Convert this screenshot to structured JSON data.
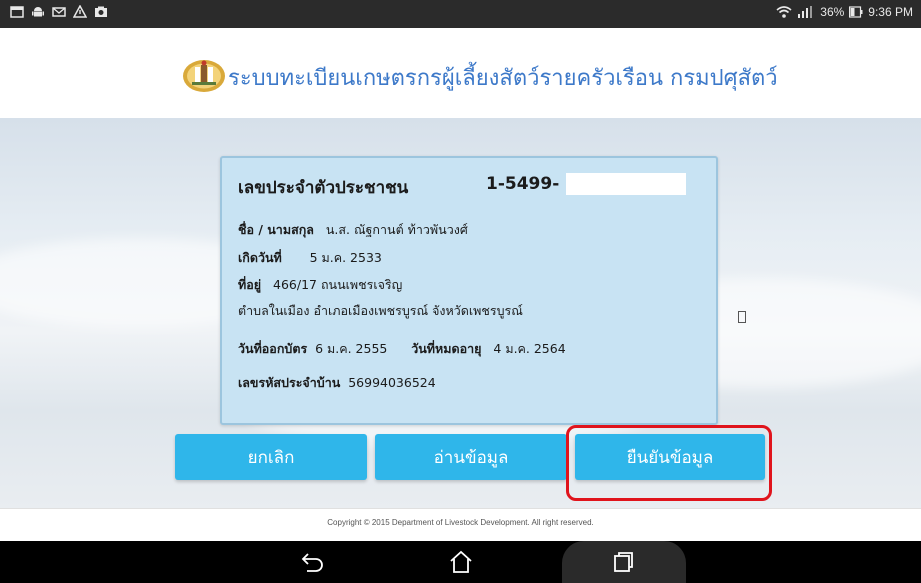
{
  "status_bar": {
    "left_icons": [
      "screen-icon",
      "android-icon",
      "mail-icon",
      "warning-icon",
      "photo-icon"
    ],
    "battery_percent": "36%",
    "time": "9:36 PM"
  },
  "header": {
    "title": "ระบบทะเบียนเกษตรกรผู้เลี้ยงสัตว์รายครัวเรือน กรมปศุสัตว์",
    "logo_icon": "department-seal-icon"
  },
  "card": {
    "title": "เลขประจำตัวประชาชน",
    "id_number": "1-5499-",
    "name_label": "ชื่อ / นามสกุล",
    "name_value": "น.ส. ณัฐกานต์ ท้าวพันวงศ์",
    "birth_label": "เกิดวันที่",
    "birth_value": "5 ม.ค. 2533",
    "address_label": "ที่อยู่",
    "address_line1": "466/17  ถนนเพชรเจริญ",
    "address_line2": "ตำบลในเมือง อำเภอเมืองเพชรบูรณ์ จังหวัดเพชรบูรณ์",
    "issue_label": "วันที่ออกบัตร",
    "issue_value": "6 ม.ค. 2555",
    "expire_label": "วันที่หมดอายุ",
    "expire_value": "4 ม.ค. 2564",
    "house_label": "เลขรหัสประจำบ้าน",
    "house_value": "56994036524"
  },
  "buttons": {
    "cancel": "ยกเลิก",
    "read": "อ่านข้อมูล",
    "confirm": "ยืนยันข้อมูล"
  },
  "footer": {
    "copyright": "Copyright © 2015 Department of Livestock Development. All right reserved."
  },
  "colors": {
    "accent": "#2fb6ea",
    "title_blue": "#3d79c9",
    "card_bg": "#c8e3f3",
    "highlight": "#e0141c"
  }
}
